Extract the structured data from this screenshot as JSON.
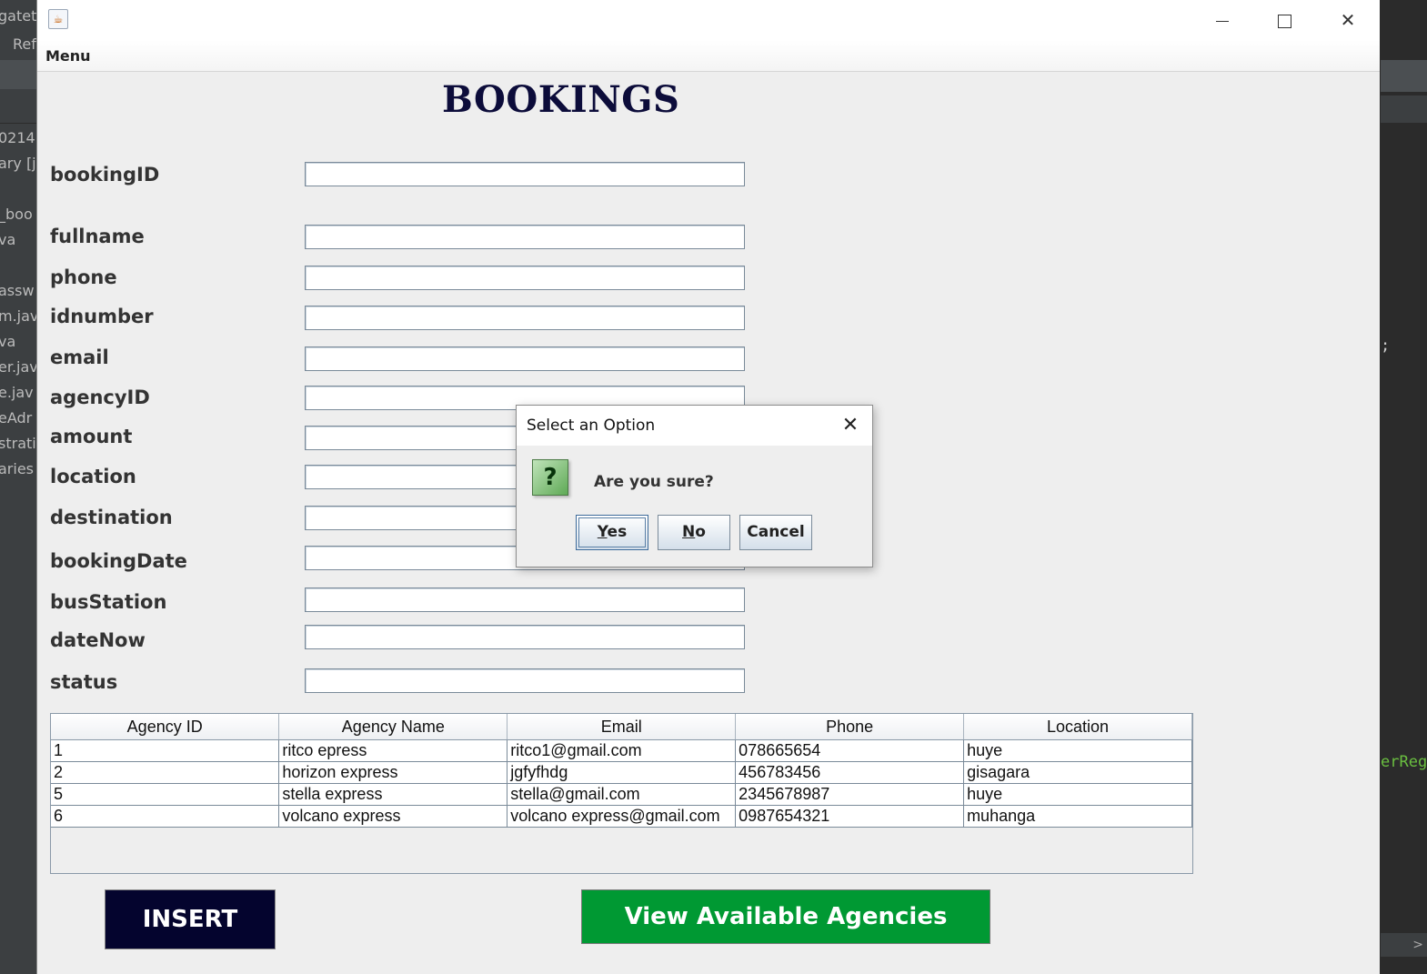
{
  "background": {
    "left_fragments": [
      "gatet",
      "Ref",
      "0214",
      "ary [j",
      "_boo",
      "va",
      "assw",
      "m.jav",
      "va",
      "er.jav",
      "e.jav",
      "eAdr",
      "stratic",
      "aries"
    ],
    "right_code": "erReg",
    "right_semicolon": ";",
    "right_scroll_arrow": ">"
  },
  "window": {
    "app_icon": "java-cup-icon",
    "menu_label": "Menu",
    "controls": [
      "minimize-icon",
      "maximize-icon",
      "close-icon"
    ]
  },
  "form": {
    "title": "BOOKINGS",
    "fields": [
      {
        "label": "bookingID",
        "value": ""
      },
      {
        "label": "fullname",
        "value": ""
      },
      {
        "label": "phone",
        "value": ""
      },
      {
        "label": "idnumber",
        "value": ""
      },
      {
        "label": "email",
        "value": ""
      },
      {
        "label": "agencyID",
        "value": ""
      },
      {
        "label": "amount",
        "value": ""
      },
      {
        "label": "location",
        "value": ""
      },
      {
        "label": "destination",
        "value": ""
      },
      {
        "label": "bookingDate",
        "value": ""
      },
      {
        "label": "busStation",
        "value": ""
      },
      {
        "label": "dateNow",
        "value": ""
      },
      {
        "label": "status",
        "value": ""
      }
    ]
  },
  "table": {
    "headers": [
      "Agency ID",
      "Agency Name",
      "Email",
      "Phone",
      "Location"
    ],
    "rows": [
      [
        "1",
        "ritco epress",
        "ritco1@gmail.com",
        "078665654",
        "huye"
      ],
      [
        "2",
        "horizon express",
        "jgfyfhdg",
        "456783456",
        "gisagara"
      ],
      [
        "5",
        "stella express",
        "stella@gmail.com",
        "2345678987",
        "huye"
      ],
      [
        "6",
        "volcano express",
        "volcano express@gmail.com",
        "0987654321",
        "muhanga"
      ]
    ]
  },
  "buttons": {
    "insert": "INSERT",
    "view_agencies": "View Available Agencies",
    "insert_bg": "#04042e",
    "view_bg": "#009933"
  },
  "dialog": {
    "title": "Select an Option",
    "icon": "question-icon",
    "icon_glyph": "?",
    "message": "Are you sure?",
    "yes_mnemonic": "Y",
    "yes_rest": "es",
    "no_mnemonic": "N",
    "no_rest": "o",
    "cancel": "Cancel"
  }
}
